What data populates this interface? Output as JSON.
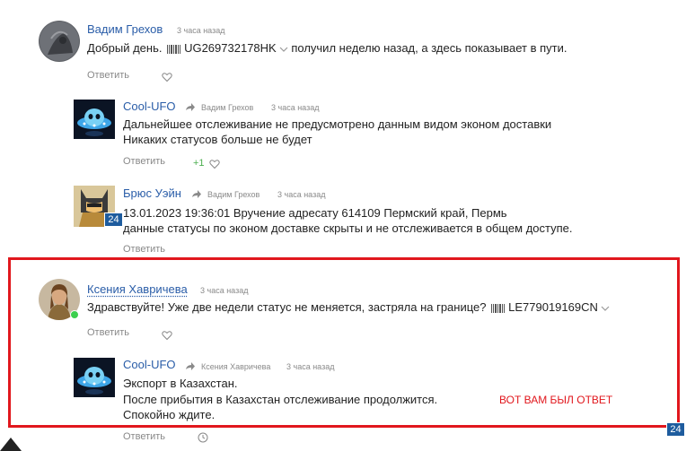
{
  "comments": [
    {
      "author": "Вадим Грехов",
      "time": "3 часа назад",
      "text_before": "Добрый день.",
      "tracking": "UG269732178HK",
      "text_after": "получил неделю назад, а здесь показывает в пути.",
      "reply_label": "Ответить"
    },
    {
      "author": "Cool-UFO",
      "reply_to": "Вадим Грехов",
      "time": "3 часа назад",
      "lines": [
        "Дальнейшее отслеживание не предусмотрено данным видом эконом доставки",
        "Никаких статусов больше не будет"
      ],
      "reply_label": "Ответить",
      "likes": "+1"
    },
    {
      "author": "Брюс Уэйн",
      "reply_to": "Вадим Грехов",
      "time": "3 часа назад",
      "lines": [
        "13.01.2023 19:36:01 Вручение адресату 614109 Пермский край, Пермь",
        "данные статусы по эконом доставке скрыты и не отслеживается в общем доступе."
      ],
      "reply_label": "Ответить",
      "badge": "24"
    },
    {
      "author": "Ксения Хавричева",
      "time": "3 часа назад",
      "text_before": "Здравствуйте! Уже две недели статус не меняется, застряла на границе?",
      "tracking": "LE779019169CN",
      "reply_label": "Ответить"
    },
    {
      "author": "Cool-UFO",
      "reply_to": "Ксения Хавричева",
      "time": "3 часа назад",
      "lines": [
        "Экспорт в Казахстан.",
        "После прибытия в Казахстан отслеживание продолжится.",
        "Спокойно ждите."
      ],
      "reply_label": "Ответить"
    }
  ],
  "annotation": "ВОТ ВАМ БЫЛ ОТВЕТ",
  "corner_badge": "24",
  "colors": {
    "author": "#2a5da8",
    "highlight": "#e1171d",
    "badge": "#1e5c9e",
    "online": "#3ccf4e",
    "likes": "#4caf50"
  }
}
